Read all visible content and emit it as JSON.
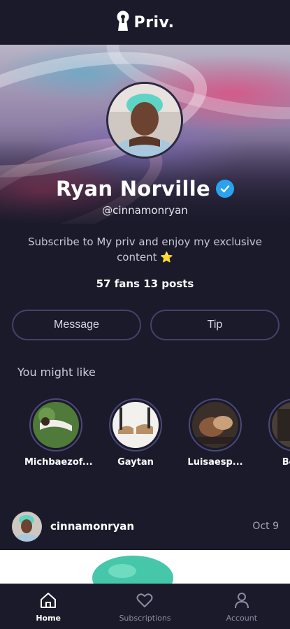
{
  "app": {
    "brand": "Priv."
  },
  "profile": {
    "name": "Ryan Norville",
    "handle": "@cinnamonryan",
    "bio": "Subscribe to My priv and enjoy my exclusive content ⭐",
    "stats": "57 fans 13 posts",
    "verified": true
  },
  "actions": {
    "message_label": "Message",
    "tip_label": "Tip"
  },
  "suggestions": {
    "title": "You might like",
    "items": [
      {
        "label": "Michbaezof..."
      },
      {
        "label": "Gaytan"
      },
      {
        "label": "Luisaesp..."
      },
      {
        "label": "Belle"
      }
    ]
  },
  "post": {
    "username": "cinnamonryan",
    "date": "Oct 9"
  },
  "nav": {
    "items": [
      {
        "label": "Home",
        "icon": "home-icon",
        "active": true
      },
      {
        "label": "Subscriptions",
        "icon": "heart-icon",
        "active": false
      },
      {
        "label": "Account",
        "icon": "person-icon",
        "active": false
      }
    ]
  },
  "colors": {
    "background": "#1b1a2b",
    "verified": "#29a3ef",
    "button_border": "#44426a",
    "ring": "#4a4878"
  }
}
